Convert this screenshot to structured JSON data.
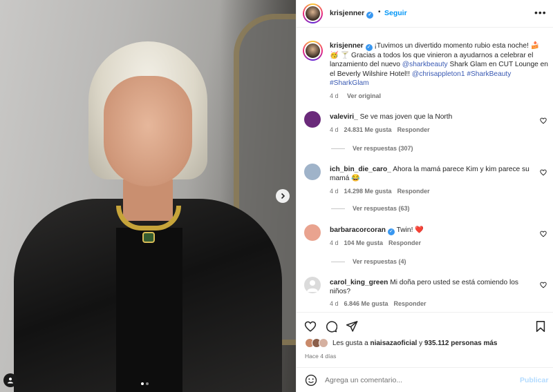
{
  "post": {
    "author": "krisjenner",
    "follow_label": "Seguir",
    "separator": "•",
    "more_icon": "more-horizontal-icon"
  },
  "caption": {
    "author": "krisjenner",
    "text_before": " ¡Tuvimos un divertido momento rubio esta noche! 🍰🥳 🍸 Gracias a todos los que vinieron a ayudarnos a celebrar el lanzamiento del nuevo ",
    "mention1": "@sharkbeauty",
    "text_mid": " Shark Glam en CUT Lounge en el Beverly Wilshire Hotel!! ",
    "mention2": "@chrisappleton1",
    "hashtag1": "#SharkBeauty",
    "hashtag2": "#SharkGlam",
    "time": "4 d",
    "see_original": "Ver original"
  },
  "comments": [
    {
      "user": "valeviri_",
      "text": "Se ve mas joven que la North",
      "time": "4 d",
      "likes": "24.831 Me gusta",
      "reply": "Responder",
      "replies": "Ver respuestas (307)",
      "verified": false,
      "avatar_color": "#6a2a7a"
    },
    {
      "user": "ich_bin_die_caro_",
      "text": "Ahora la mamá parece Kim y kim parece su mamá 😂",
      "time": "4 d",
      "likes": "14.298 Me gusta",
      "reply": "Responder",
      "replies": "Ver respuestas (63)",
      "verified": false,
      "avatar_color": "#9fb3c9"
    },
    {
      "user": "barbaracorcoran",
      "text": "Twin! ❤️",
      "time": "4 d",
      "likes": "104 Me gusta",
      "reply": "Responder",
      "replies": "Ver respuestas (4)",
      "verified": true,
      "avatar_color": "#e9a38f"
    },
    {
      "user": "carol_king_green",
      "text": "Mi doña pero usted se está comiendo los niños?",
      "time": "4 d",
      "likes": "6.846 Me gusta",
      "reply": "Responder",
      "replies": "",
      "verified": false,
      "avatar_color": "#dbdbdb"
    }
  ],
  "likes": {
    "prefix": "Les gusta a ",
    "user": "niaisazaoficial",
    "mid": " y ",
    "count": "935.112 personas más"
  },
  "posted_ago": "Hace 4 días",
  "composer": {
    "placeholder": "Agrega un comentario...",
    "post_label": "Publicar"
  },
  "colors": {
    "accent": "#0095f6",
    "verified": "#3897f0",
    "muted": "#737373",
    "link": "#3a5ab3"
  }
}
